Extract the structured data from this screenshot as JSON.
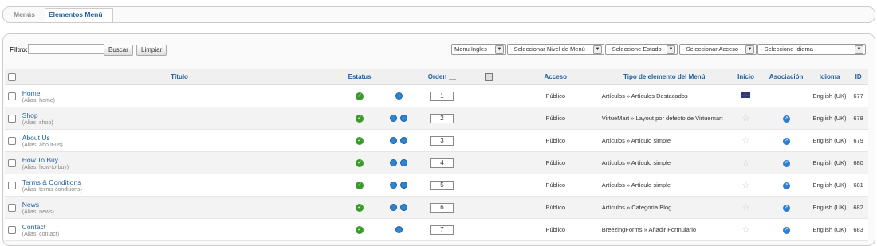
{
  "tabs": [
    {
      "label": "Menús"
    },
    {
      "label": "Elementos Menú"
    }
  ],
  "filter": {
    "label": "Filtro:",
    "value": "",
    "search_label": "Buscar",
    "clear_label": "Limpiar"
  },
  "selects": {
    "menu": "Menu Ingles",
    "level": "- Seleccionar Nivel de Menú -",
    "state": "- Seleccione Estado -",
    "access": "- Seleccionar Acceso -",
    "language": "- Seleccione Idioma -"
  },
  "columns": {
    "title": "Título",
    "status": "Estatus",
    "order": "Orden",
    "access": "Acceso",
    "type": "Tipo de elemento del Menú",
    "home": "Inicio",
    "assoc": "Asociación",
    "language": "Idioma",
    "id": "ID"
  },
  "rows": [
    {
      "title": "Home",
      "alias": "(Alias: home)",
      "order": "1",
      "access": "Público",
      "type": "Artículos » Artículos Destacados",
      "home": true,
      "language": "English (UK)",
      "id": "677"
    },
    {
      "title": "Shop",
      "alias": "(Alias: shop)",
      "order": "2",
      "access": "Público",
      "type": "VirtueMart » Layout por defecto de Virtuemart",
      "home": false,
      "language": "English (UK)",
      "id": "678"
    },
    {
      "title": "About Us",
      "alias": "(Alias: about-us)",
      "order": "3",
      "access": "Público",
      "type": "Artículos » Artículo simple",
      "home": false,
      "language": "English (UK)",
      "id": "679"
    },
    {
      "title": "How To Buy",
      "alias": "(Alias: how-to-buy)",
      "order": "4",
      "access": "Público",
      "type": "Artículos » Artículo simple",
      "home": false,
      "language": "English (UK)",
      "id": "680"
    },
    {
      "title": "Terms & Conditions",
      "alias": "(Alias: terms-conditions)",
      "order": "5",
      "access": "Público",
      "type": "Artículos » Artículo simple",
      "home": false,
      "language": "English (UK)",
      "id": "681"
    },
    {
      "title": "News",
      "alias": "(Alias: news)",
      "order": "6",
      "access": "Público",
      "type": "Artículos » Categoría Blog",
      "home": false,
      "language": "English (UK)",
      "id": "682"
    },
    {
      "title": "Contact",
      "alias": "(Alias: contact)",
      "order": "7",
      "access": "Público",
      "type": "BreezingForms » Añadir Formulario",
      "home": false,
      "language": "English (UK)",
      "id": "683"
    }
  ],
  "colors": {
    "link": "#1e5f9e",
    "status_ok": "#3a9a2a",
    "assoc": "#2a7fd4"
  }
}
